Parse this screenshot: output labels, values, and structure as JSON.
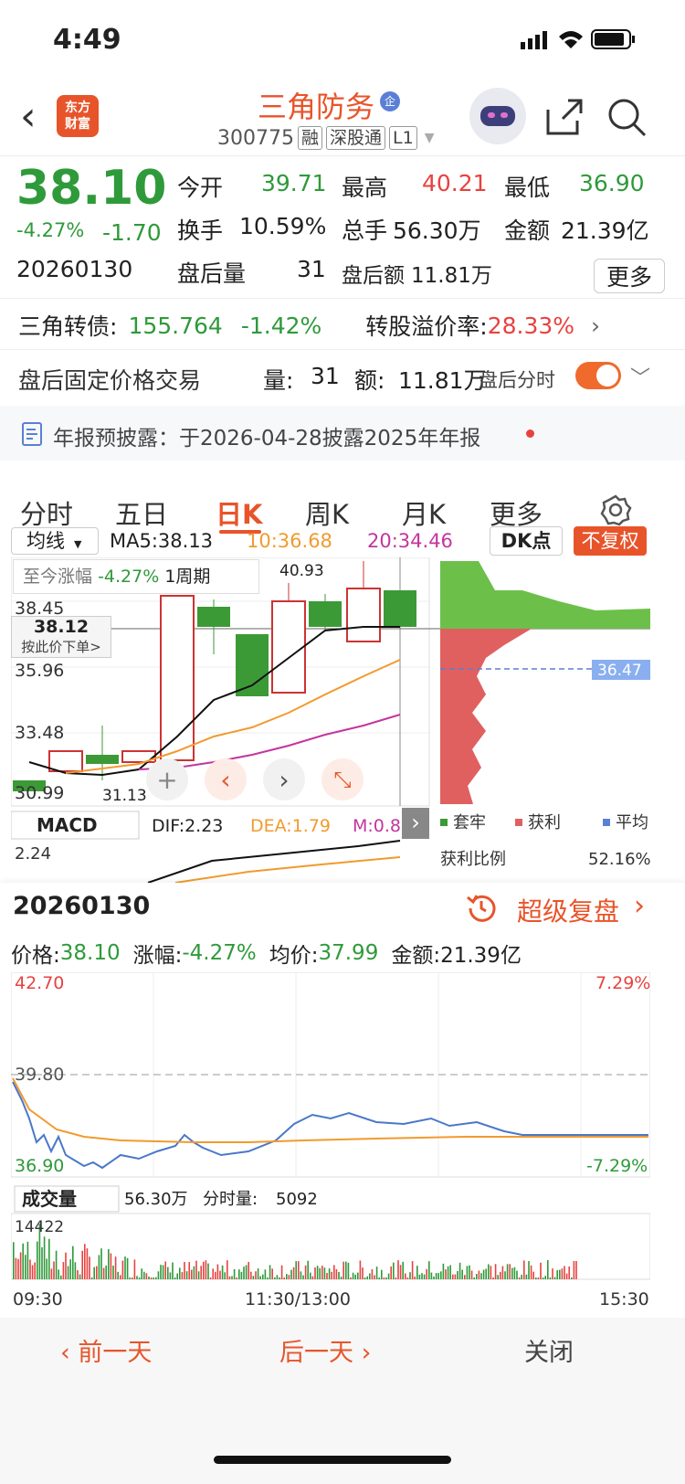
{
  "status": {
    "time": "4:49"
  },
  "header": {
    "logo_text": "东方\n财富",
    "title": "三角防务",
    "title_badge": "企",
    "code": "300775",
    "tags": [
      "融",
      "深股通",
      "L1"
    ]
  },
  "quote": {
    "price": "38.10",
    "change_pct": "-4.27%",
    "change": "-1.70",
    "date": "20260130",
    "open_label": "今开",
    "open": "39.71",
    "high_label": "最高",
    "high": "40.21",
    "low_label": "最低",
    "low": "36.90",
    "turnover_label": "换手",
    "turnover": "10.59%",
    "volume_label": "总手",
    "volume": "56.30万",
    "amount_label": "金额",
    "amount": "21.39亿",
    "after_vol_label": "盘后量",
    "after_vol": "31",
    "after_amt_label": "盘后额",
    "after_amt": "11.81万",
    "more": "更多"
  },
  "bond": {
    "label": "三角转债:",
    "price": "155.764",
    "pct": "-1.42%",
    "premium_label": "转股溢价率:",
    "premium": "28.33%"
  },
  "after_hours": {
    "label": "盘后固定价格交易",
    "vol_label": "量:",
    "vol": "31",
    "amt_label": "额:",
    "amt": "11.81万",
    "switch_label": "盘后分时"
  },
  "notice": {
    "text": "年报预披露：于2026-04-28披露2025年年报"
  },
  "tabs": [
    "分时",
    "五日",
    "日K",
    "周K",
    "月K",
    "更多"
  ],
  "kline": {
    "ma_select": "均线",
    "ma5": "MA5:38.13",
    "ma10": "10:36.68",
    "ma20": "20:34.46",
    "dk": "DK点",
    "fq": "不复权",
    "range_label": "至今涨幅",
    "range_pct": "-4.27%",
    "range_period": "1周期",
    "ticks": [
      "38.45",
      "35.96",
      "33.48",
      "30.99"
    ],
    "high_mark": "40.93",
    "low_mark": "31.13",
    "cursor_price": "38.12",
    "cursor_hint": "按此价下单>",
    "dist_price": "36.47",
    "macd_select": "MACD",
    "dif": "DIF:2.23",
    "dea": "DEA:1.79",
    "m": "M:0.8",
    "macd_tick": "2.24",
    "legend": [
      "套牢",
      "获利",
      "平均"
    ],
    "profit_label": "获利比例",
    "profit": "52.16%"
  },
  "panel": {
    "date": "20260130",
    "replay": "超级复盘",
    "price_label": "价格:",
    "price": "38.10",
    "pct_label": "涨幅:",
    "pct": "-4.27%",
    "avg_label": "均价:",
    "avg": "37.99",
    "amt_label": "金额:",
    "amt": "21.39亿",
    "y_top": "42.70",
    "y_mid": "39.80",
    "y_bot": "36.90",
    "p_top": "7.29%",
    "p_bot": "-7.29%",
    "vol_select": "成交量",
    "vol_total": "56.30万",
    "vol_min_label": "分时量:",
    "vol_min": "5092",
    "vol_max": "14422",
    "t_start": "09:30",
    "t_mid": "11:30/13:00",
    "t_end": "15:30",
    "prev": "前一天",
    "next": "后一天",
    "close": "关闭"
  },
  "colors": {
    "red": "#e8423f",
    "green": "#2f9a3a",
    "orange": "#f29a2e",
    "blue": "#4a78c9"
  }
}
